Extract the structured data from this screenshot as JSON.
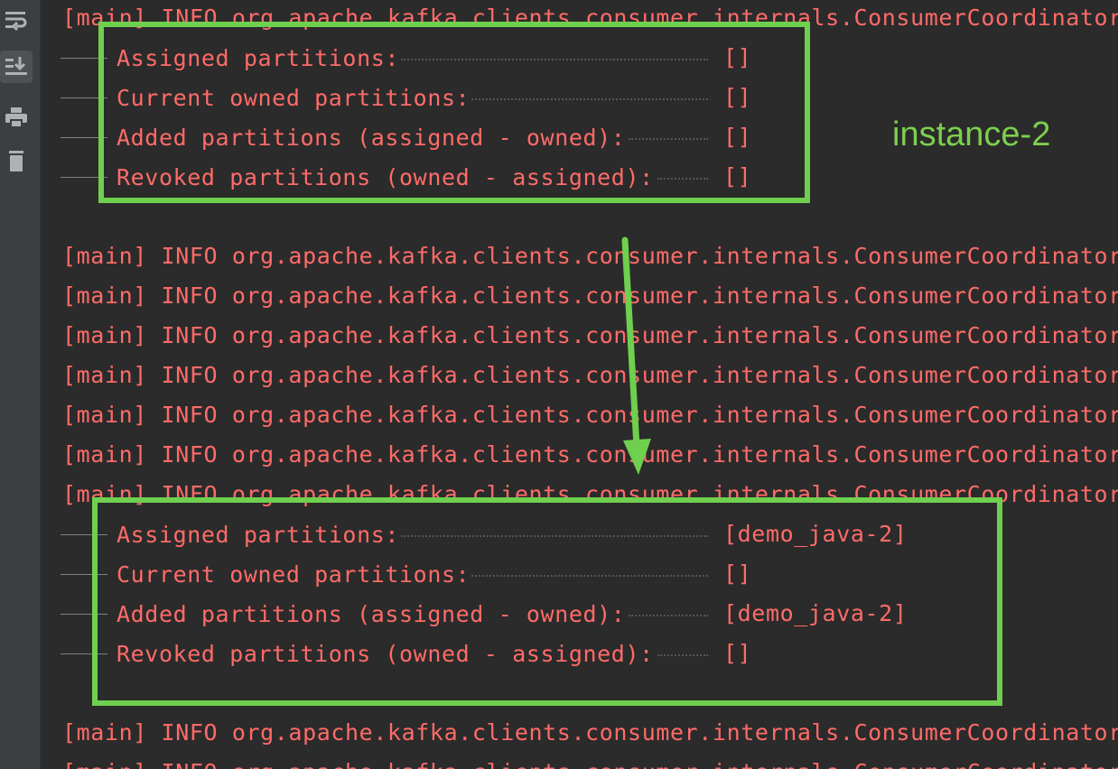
{
  "toolbar": {
    "items": [
      {
        "icon": "soft-wrap-icon"
      },
      {
        "icon": "scroll-to-end-icon",
        "active": true
      },
      {
        "icon": "print-icon"
      },
      {
        "icon": "trash-icon"
      }
    ]
  },
  "console": {
    "log_prefix": "[main] INFO org.apache.kafka.clients.consumer.internals.ConsumerCoordinator",
    "block1": {
      "rows": [
        {
          "label": "Assigned partitions:",
          "value": "[]"
        },
        {
          "label": "Current owned partitions:",
          "value": "[]"
        },
        {
          "label": "Added partitions (assigned - owned):",
          "value": "[]"
        },
        {
          "label": "Revoked partitions (owned - assigned):",
          "value": "[]"
        }
      ]
    },
    "block2": {
      "rows": [
        {
          "label": "Assigned partitions:",
          "value": "[demo_java-2]"
        },
        {
          "label": "Current owned partitions:",
          "value": "[]"
        },
        {
          "label": "Added partitions (assigned - owned):",
          "value": "[demo_java-2]"
        },
        {
          "label": "Revoked partitions (owned - assigned):",
          "value": "[]"
        }
      ]
    }
  },
  "annotation": {
    "label": "instance-2",
    "color": "#6fcf4e",
    "text_color": "#ff6b68"
  }
}
